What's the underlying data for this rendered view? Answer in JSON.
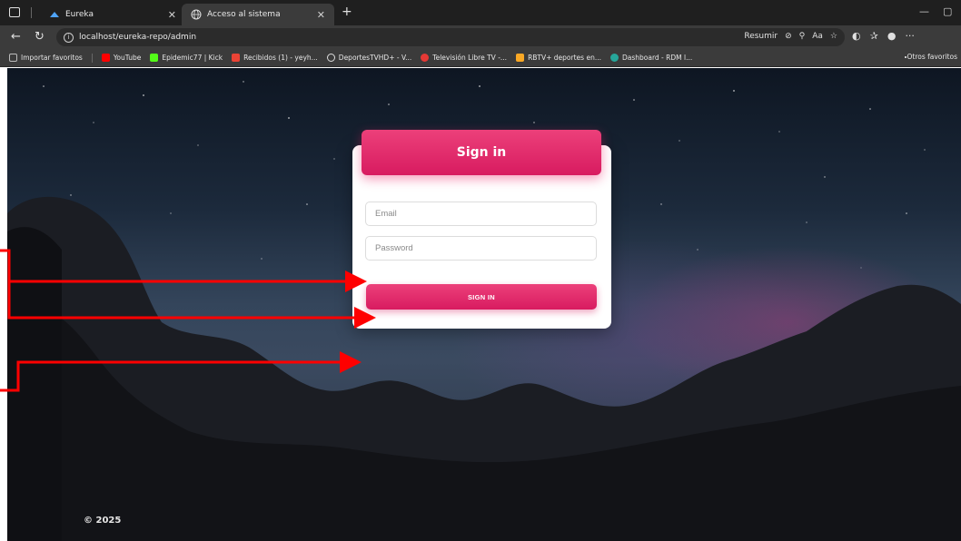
{
  "browser": {
    "tabs": [
      {
        "label": "Eureka",
        "active": false
      },
      {
        "label": "Acceso al sistema",
        "active": true
      }
    ],
    "url": "localhost/eureka-repo/admin",
    "summarize_label": "Resumir",
    "bookmarks": [
      {
        "label": "Importar favoritos",
        "color": "#9e9e9e"
      },
      {
        "label": "YouTube",
        "color": "#ff0000"
      },
      {
        "label": "Epidemic77 | Kick",
        "color": "#53fc18"
      },
      {
        "label": "Recibidos (1) - yeyh...",
        "color": "#ea4335"
      },
      {
        "label": "DeportesTVHD+ - V...",
        "color": "#ffffff"
      },
      {
        "label": "Televisión Libre TV -...",
        "color": "#e53935"
      },
      {
        "label": "RBTV+ deportes en...",
        "color": "#f9a825"
      },
      {
        "label": "Dashboard - RDM l...",
        "color": "#26a69a"
      }
    ],
    "other_favorites": "Otros favoritos"
  },
  "login": {
    "title": "Sign in",
    "email_placeholder": "Email",
    "password_placeholder": "Password",
    "submit_label": "SIGN IN"
  },
  "footer": {
    "copyright": "© 2025"
  },
  "colors": {
    "accent": "#e91e63",
    "annotation": "#ff0000"
  }
}
